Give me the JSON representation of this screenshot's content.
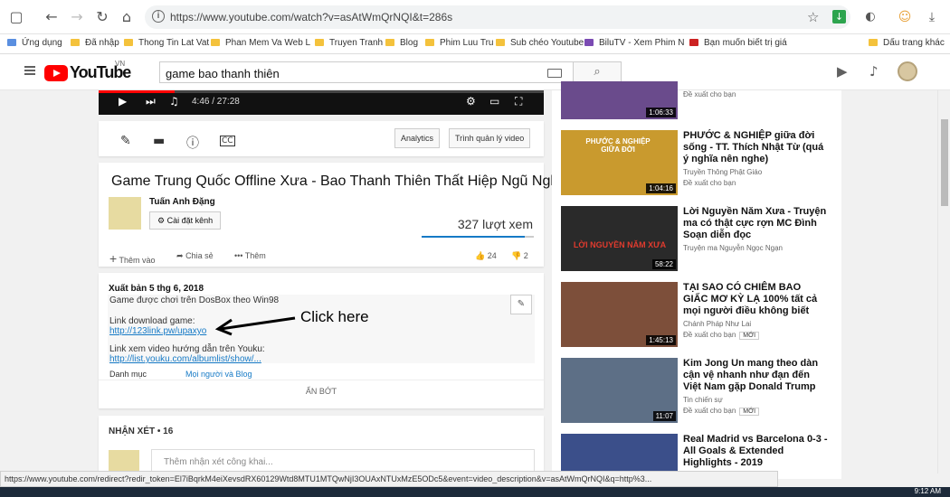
{
  "browser": {
    "url": "https://www.youtube.com/watch?v=asAtWmQrNQI&t=286s",
    "bookmarks": [
      "Ứng dụng",
      "Đã nhập",
      "Thong Tin Lat Vat",
      "Phan Mem Va Web L",
      "Truyen Tranh",
      "Blog",
      "Phim Luu Tru",
      "Sub chéo Youtube",
      "BiluTV - Xem Phim N",
      "Bạn muốn biết trị giá",
      "Dấu trang khác"
    ]
  },
  "youtube": {
    "logo": "YouTube",
    "region": "VN",
    "search_query": "game bao thanh thiên"
  },
  "player": {
    "time": "4:46 / 27:28",
    "progress": 0.17
  },
  "toolbar": {
    "analytics": "Analytics",
    "manager": "Trình quản lý video"
  },
  "video": {
    "title": "Game Trung Quốc Offline Xưa - Bao Thanh Thiên Thất Hiệp Ngũ Nghĩ",
    "channel": "Tuấn Anh Đặng",
    "settings": "Cài đặt kênh",
    "views": "327 lượt xem",
    "like_ratio": 0.92,
    "add_to": "Thêm vào",
    "share": "Chia sẻ",
    "more": "Thêm",
    "likes": "24",
    "dislikes": "2"
  },
  "description": {
    "published": "Xuất bản 5 thg 6, 2018",
    "line1": "Game được chơi trên DosBox theo Win98",
    "line2": "Link download game:",
    "link1": "http://123link.pw/upaxyo",
    "line3": "Link xem video hướng dẫn trên Youku:",
    "link2": "http://list.youku.com/albumlist/show/...",
    "category_label": "Danh mục",
    "category_value": "Mọi người và Blog",
    "show_less": "ẨN BỚT"
  },
  "annotation": "Click here",
  "comments": {
    "header": "NHẬN XÉT • 16",
    "placeholder": "Thêm nhận xét công khai..."
  },
  "sidebar": [
    {
      "title": "",
      "channel": "",
      "sugg": "Đề xuất cho bạn",
      "dur": "1:06:33",
      "new": ""
    },
    {
      "title": "PHƯỚC & NGHIỆP giữa đời sống - TT. Thích Nhật Từ (quá ý nghĩa nên nghe)",
      "channel": "Truyền Thông Phật Giáo",
      "sugg": "Đề xuất cho bạn",
      "dur": "1:04:16",
      "new": "",
      "thumb_text": "PHƯỚC & NGHIỆP GIỮA ĐỜI"
    },
    {
      "title": "Lời Nguyền Năm Xưa - Truyện ma có thật cực rợn MC Đình Soạn diễn đọc",
      "channel": "Truyện ma Nguyễn Ngọc Ngạn",
      "sugg": "",
      "dur": "58:22",
      "new": "",
      "thumb_text": "LỜI NGUYỀN NĂM XƯA"
    },
    {
      "title": "TẠI SAO CÓ CHIÊM BAO GIẤC MƠ KỲ LẠ 100% tất cả mọi người điều không biết",
      "channel": "Chánh Pháp Như Lai",
      "sugg": "Đề xuất cho bạn",
      "dur": "1:45:13",
      "new": "MỚI"
    },
    {
      "title": "Kim Jong Un mang theo dàn cận vệ nhanh như đạn đến Việt Nam gặp Donald Trump",
      "channel": "Tin chiến sự",
      "sugg": "Đề xuất cho bạn",
      "dur": "11:07",
      "new": "MỚI"
    },
    {
      "title": "Real Madrid vs Barcelona 0-3 - All Goals & Extended Highlights - 2019",
      "channel": "",
      "sugg": "",
      "dur": "",
      "new": ""
    }
  ],
  "status_url": "https://www.youtube.com/redirect?redir_token=El7iBqrkM4eiXevsdRX60129Wtd8MTU1MTQwNjI3OUAxNTUxMzE5ODc5&event=video_description&v=asAtWmQrNQI&q=http%3...",
  "clock": "9:12 AM"
}
